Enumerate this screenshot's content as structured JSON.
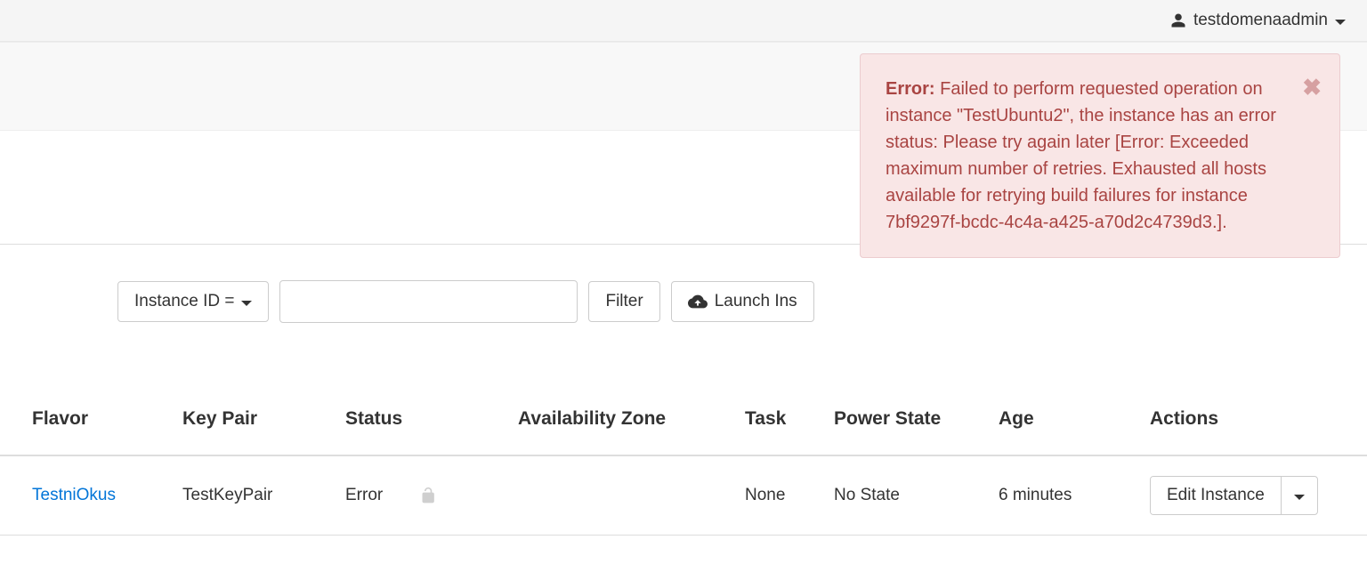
{
  "header": {
    "username": "testdomenaadmin"
  },
  "alert": {
    "label": "Error:",
    "message": "Failed to perform requested operation on instance \"TestUbuntu2\", the instance has an error status: Please try again later [Error: Exceeded maximum number of retries. Exhausted all hosts available for retrying build failures for instance 7bf9297f-bcdc-4c4a-a425-a70d2c4739d3.]."
  },
  "toolbar": {
    "filter_by_label": "Instance ID =",
    "search_value": "",
    "filter_button": "Filter",
    "launch_button": "Launch Ins"
  },
  "table": {
    "columns": {
      "flavor": "Flavor",
      "keypair": "Key Pair",
      "status": "Status",
      "az": "Availability Zone",
      "task": "Task",
      "power": "Power State",
      "age": "Age",
      "actions": "Actions"
    },
    "rows": [
      {
        "flavor": "TestniOkus",
        "keypair": "TestKeyPair",
        "status": "Error",
        "az": "",
        "task": "None",
        "power": "No State",
        "age": "6 minutes",
        "action_label": "Edit Instance"
      }
    ]
  }
}
